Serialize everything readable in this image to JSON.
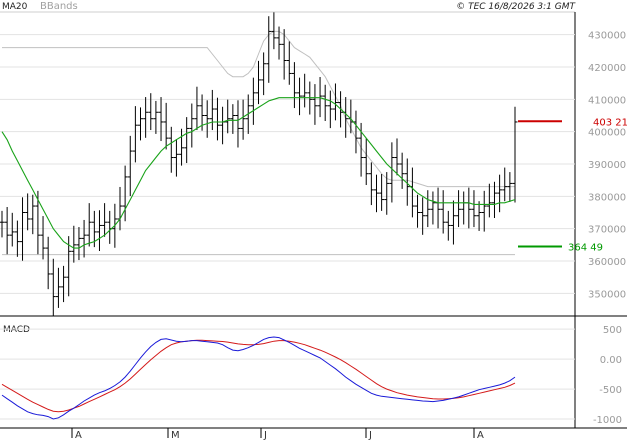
{
  "header": {
    "legend_ma": "MA20",
    "legend_bb": "BBands",
    "copyright": "© TEC 16/8/2026 3:1 GMT"
  },
  "price_panel": {
    "y_ticks": [
      "430000",
      "420000",
      "410000",
      "400000",
      "390000",
      "380000",
      "370000",
      "360000",
      "350000"
    ],
    "level_red": "403 21",
    "level_green": "364 49"
  },
  "macd_panel": {
    "title": "MACD",
    "y_ticks": [
      "500",
      "0.00",
      "-500",
      "-1000"
    ]
  },
  "x_axis": {
    "months": [
      "A",
      "M",
      "J",
      "J",
      "A"
    ]
  },
  "colors": {
    "price_bar": "#000000",
    "ma20": "#1aa31a",
    "bbands": "#c0c0c0",
    "macd": "#1a1ad8",
    "signal": "#d41a1a",
    "level_red": "#cc0000",
    "level_green": "#009900",
    "frame": "#000000"
  },
  "chart_data": [
    {
      "type": "ohlc",
      "indicators": [
        "MA20",
        "BBands"
      ],
      "ylim": [
        343000,
        437000
      ],
      "y_ticks": [
        350000,
        360000,
        370000,
        380000,
        390000,
        400000,
        410000,
        420000,
        430000
      ],
      "x_months": [
        "A",
        "M",
        "J",
        "J",
        "A"
      ],
      "levels": [
        {
          "label": "403 21",
          "value": 403210,
          "color": "red"
        },
        {
          "label": "364 49",
          "value": 364490,
          "color": "green"
        }
      ],
      "close": [
        372000,
        368000,
        369000,
        366000,
        375000,
        373000,
        377000,
        368000,
        364000,
        356000,
        349000,
        352000,
        355000,
        363000,
        365000,
        367000,
        368000,
        372000,
        369000,
        371000,
        372000,
        370000,
        373000,
        377000,
        386000,
        394000,
        402000,
        404000,
        406000,
        404000,
        406000,
        403000,
        398000,
        392000,
        393000,
        395000,
        401000,
        404000,
        408000,
        405000,
        404000,
        407000,
        402000,
        403000,
        404000,
        405000,
        401000,
        404000,
        408000,
        412000,
        416000,
        421000,
        431000,
        429000,
        427000,
        422000,
        418000,
        412000,
        411000,
        412000,
        410000,
        408000,
        411000,
        408000,
        407000,
        409000,
        406000,
        404000,
        403000,
        398000,
        392000,
        387000,
        382000,
        381000,
        379000,
        384000,
        392000,
        390000,
        387000,
        383000,
        377000,
        375000,
        374000,
        376000,
        378000,
        376000,
        372000,
        371000,
        374000,
        376000,
        378000,
        376000,
        374000,
        375000,
        377000,
        378000,
        381000,
        382000,
        383000,
        384000,
        403000
      ],
      "ma20": [
        400000,
        397500,
        394000,
        391000,
        388000,
        385000,
        382000,
        379000,
        376000,
        373000,
        370000,
        368000,
        366000,
        365000,
        364000,
        364000,
        365000,
        365500,
        366000,
        367000,
        368000,
        369500,
        371000,
        373000,
        376000,
        379000,
        382000,
        385000,
        388000,
        390000,
        392000,
        394000,
        395500,
        396500,
        397500,
        398500,
        399500,
        400000,
        401000,
        402000,
        402500,
        403000,
        403000,
        403000,
        403500,
        403500,
        403500,
        404500,
        405500,
        406500,
        407500,
        408500,
        409500,
        410000,
        410500,
        410500,
        410500,
        410500,
        410500,
        410500,
        410500,
        410500,
        410500,
        410000,
        409500,
        408500,
        407000,
        405500,
        404000,
        402000,
        400000,
        398000,
        396000,
        394000,
        392000,
        390000,
        388500,
        387000,
        385500,
        384000,
        382500,
        381000,
        380000,
        379000,
        378500,
        378000,
        378000,
        378000,
        378000,
        378000,
        378000,
        378000,
        377500,
        377500,
        377500,
        377500,
        377500,
        378000,
        378000,
        378500,
        379000
      ],
      "bb_upper": [
        426000,
        426000,
        426000,
        426000,
        426000,
        426000,
        426000,
        426000,
        426000,
        426000,
        426000,
        426000,
        426000,
        426000,
        426000,
        426000,
        426000,
        426000,
        426000,
        426000,
        426000,
        426000,
        426000,
        426000,
        426000,
        426000,
        426000,
        426000,
        426000,
        426000,
        426000,
        426000,
        426000,
        426000,
        426000,
        426000,
        426000,
        426000,
        426000,
        426000,
        426000,
        424000,
        422000,
        420000,
        418000,
        417000,
        417000,
        417000,
        418000,
        420000,
        424000,
        428000,
        430000,
        431000,
        431000,
        430000,
        428000,
        426000,
        425000,
        424000,
        423000,
        421000,
        419000,
        417000,
        414000,
        411000,
        408000,
        404000,
        401000,
        398000,
        395000,
        393000,
        391000,
        389000,
        387000,
        385500,
        385000,
        385000,
        385000,
        385000,
        384500,
        384000,
        383500,
        383000,
        383000,
        383000,
        383000,
        383000,
        383000,
        383000,
        383000,
        383000,
        383000,
        383000,
        383000,
        383000,
        383000,
        383000,
        383000,
        383000,
        383000
      ],
      "bb_lower": [
        362000,
        362000,
        362000,
        362000,
        362000,
        362000,
        362000,
        362000,
        362000,
        362000,
        362000,
        362000,
        362000,
        362000,
        362000,
        362000,
        362000,
        362000,
        362000,
        362000,
        362000,
        362000,
        362000,
        362000,
        362000,
        362000,
        362000,
        362000,
        362000,
        362000,
        362000,
        362000,
        362000,
        362000,
        362000,
        362000,
        362000,
        362000,
        362000,
        362000,
        362000,
        362000,
        362000,
        362000,
        362000,
        362000,
        362000,
        362000,
        362000,
        362000,
        362000,
        362000,
        362000,
        362000,
        362000,
        362000,
        362000,
        362000,
        362000,
        362000,
        362000,
        362000,
        362000,
        362000,
        362000,
        362000,
        362000,
        362000,
        362000,
        362000,
        362000,
        362000,
        362000,
        362000,
        362000,
        362000,
        362000,
        362000,
        362000,
        362000,
        362000,
        362000,
        362000,
        362000,
        362000,
        362000,
        362000,
        362000,
        362000,
        362000,
        362000,
        362000,
        362000,
        362000,
        362000,
        362000,
        362000,
        362000,
        362000,
        362000,
        362000
      ]
    },
    {
      "type": "line",
      "title": "MACD",
      "ylim": [
        -1150,
        720
      ],
      "y_ticks": [
        500,
        0,
        -500,
        -1000
      ],
      "series": [
        {
          "values": [
            -600,
            -660,
            -720,
            -780,
            -830,
            -880,
            -910,
            -930,
            -940,
            -960,
            -1000,
            -980,
            -930,
            -870,
            -820,
            -760,
            -700,
            -650,
            -600,
            -560,
            -530,
            -490,
            -440,
            -380,
            -300,
            -200,
            -90,
            20,
            120,
            210,
            280,
            330,
            340,
            320,
            300,
            290,
            300,
            310,
            310,
            300,
            290,
            280,
            270,
            240,
            190,
            150,
            140,
            160,
            190,
            230,
            280,
            330,
            360,
            370,
            360,
            320,
            280,
            230,
            180,
            140,
            100,
            60,
            20,
            -40,
            -100,
            -160,
            -230,
            -300,
            -360,
            -420,
            -470,
            -520,
            -570,
            -600,
            -620,
            -630,
            -640,
            -650,
            -660,
            -670,
            -680,
            -690,
            -700,
            -705,
            -710,
            -700,
            -690,
            -670,
            -650,
            -630,
            -600,
            -570,
            -540,
            -510,
            -490,
            -470,
            -450,
            -430,
            -400,
            -360,
            -300
          ]
        },
        {
          "values": [
            -420,
            -470,
            -520,
            -570,
            -620,
            -670,
            -720,
            -760,
            -800,
            -840,
            -870,
            -880,
            -870,
            -850,
            -820,
            -790,
            -750,
            -710,
            -670,
            -630,
            -590,
            -550,
            -510,
            -460,
            -400,
            -330,
            -250,
            -170,
            -90,
            -10,
            60,
            130,
            190,
            240,
            270,
            290,
            300,
            310,
            315,
            315,
            310,
            305,
            300,
            295,
            285,
            270,
            255,
            245,
            240,
            240,
            245,
            260,
            280,
            300,
            310,
            310,
            300,
            285,
            265,
            240,
            210,
            180,
            150,
            115,
            75,
            35,
            -10,
            -60,
            -115,
            -170,
            -230,
            -290,
            -350,
            -410,
            -460,
            -500,
            -530,
            -560,
            -580,
            -600,
            -615,
            -630,
            -640,
            -650,
            -660,
            -665,
            -665,
            -660,
            -655,
            -645,
            -630,
            -610,
            -590,
            -570,
            -550,
            -530,
            -510,
            -490,
            -470,
            -440,
            -400
          ]
        }
      ]
    }
  ]
}
